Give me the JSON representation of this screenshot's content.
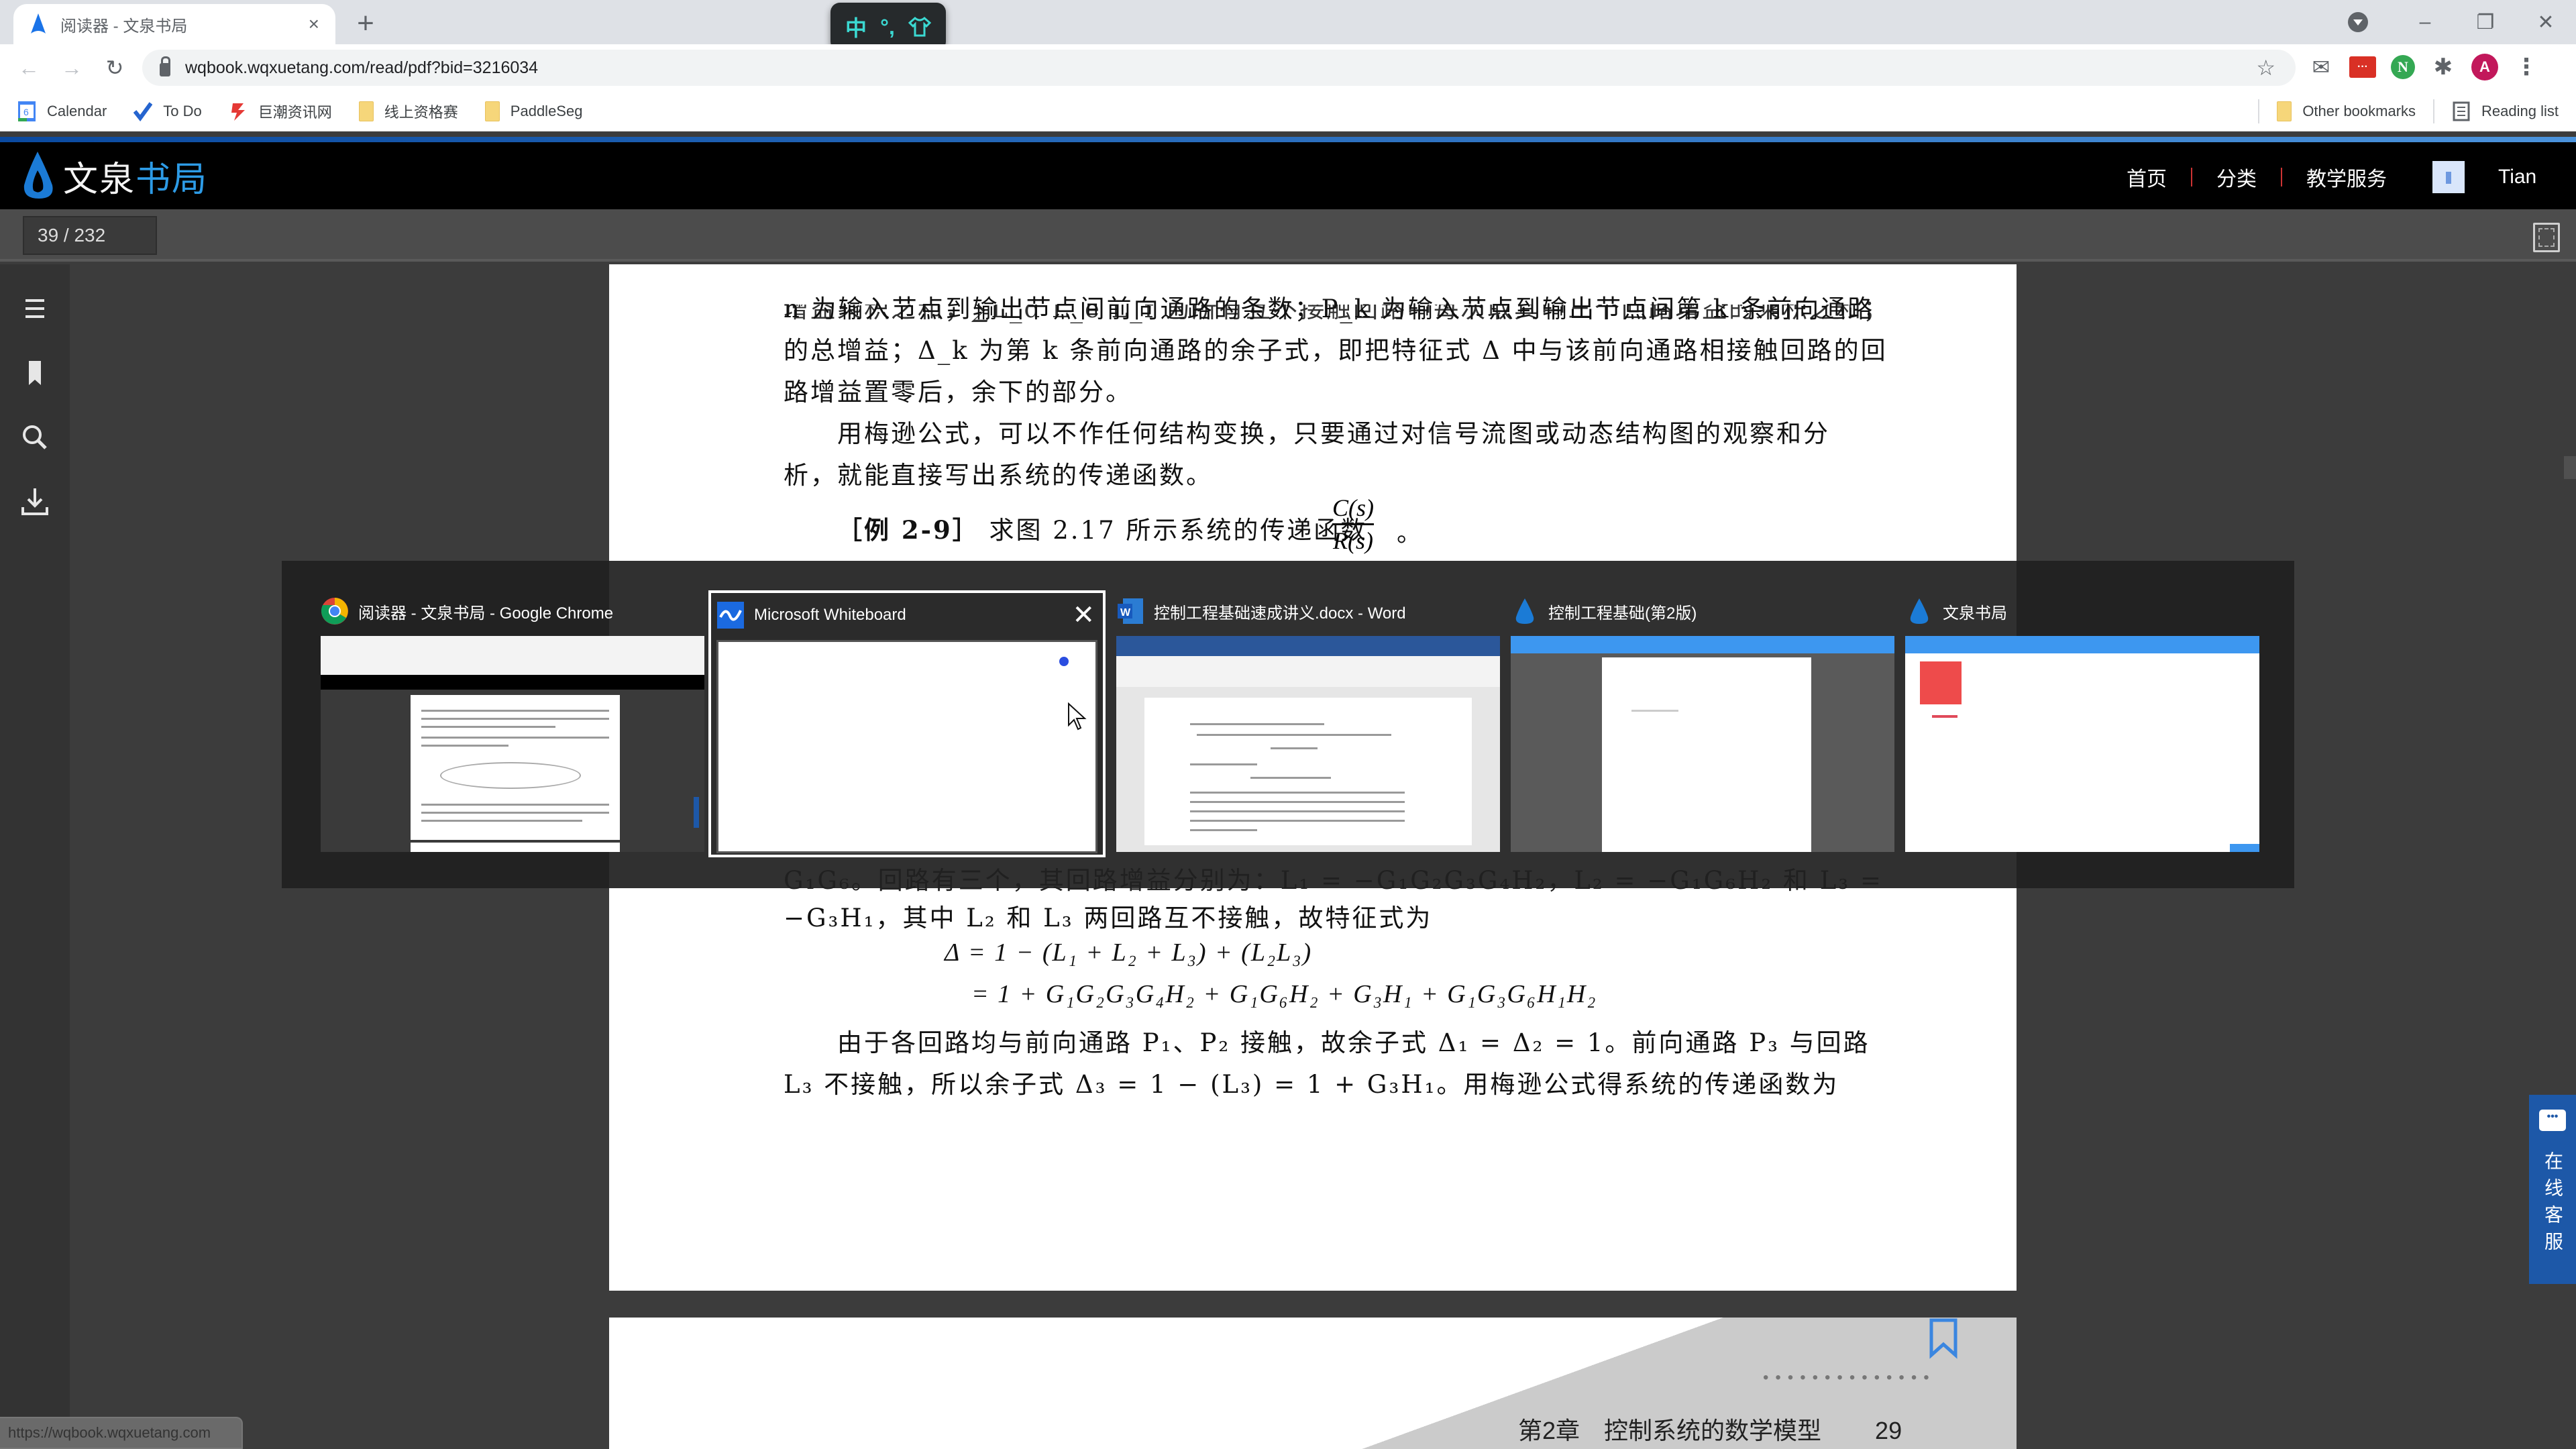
{
  "browser": {
    "tab_title": "阅读器 - 文泉书局",
    "tab_close": "×",
    "new_tab": "+",
    "url": "wqbook.wqxuetang.com/read/pdf?bid=3216034",
    "window_controls": {
      "minimize": "–",
      "restore": "❐",
      "close": "✕"
    },
    "extensions": [
      {
        "name": "mail",
        "glyph": "✉"
      },
      {
        "name": "red-extension",
        "glyph": "···"
      },
      {
        "name": "green-n",
        "glyph": "N"
      },
      {
        "name": "puzzle",
        "glyph": "✱"
      },
      {
        "name": "profile",
        "glyph": "A"
      },
      {
        "name": "menu",
        "glyph": "⋮"
      }
    ],
    "bookmarks": [
      {
        "label": "Calendar",
        "icon": "calendar-icon"
      },
      {
        "label": "To Do",
        "icon": "todo-check-icon"
      },
      {
        "label": "巨潮资讯网",
        "icon": "juchao-icon"
      },
      {
        "label": "线上资格赛",
        "icon": "folder-icon"
      },
      {
        "label": "PaddleSeg",
        "icon": "folder-icon"
      }
    ],
    "other_bookmarks": "Other bookmarks",
    "reading_list": "Reading list",
    "status_url": "https://wqbook.wqxuetang.com"
  },
  "ime": {
    "mode": "中",
    "punct": "°,",
    "skin": "👕"
  },
  "site": {
    "logo_part1": "文泉",
    "logo_part2": "书局",
    "nav": [
      "首页",
      "分类",
      "教学服务"
    ],
    "user_name": "Tian",
    "accent_color": "#2d9be6"
  },
  "reader": {
    "page_indicator": "39 / 232",
    "online_service": "在线客服",
    "page_footer_chapter": "第2章　控制系统的数学模型",
    "page_footer_number": "29"
  },
  "document": {
    "lines_top": [
      "n 为输入节点到输出节点间前向通路的条数；P_k 为输入节点到输出节点间第 k 条前向通路",
      "的总增益；Δ_k 为第 k 条前向通路的余子式，即把特征式 Δ 中与该前向通路相接触回路的回",
      "路增益置零后，余下的部分。",
      "用梅逊公式，可以不作任何结构变换，只要通过对信号流图或动态结构图的观察和分",
      "析，就能直接写出系统的传递函数。"
    ],
    "example_label": "［例 2-9］",
    "example_text": "求图 2.17 所示系统的传递函数",
    "frac_num": "C(s)",
    "frac_den": "R(s)",
    "frac_tail": "。",
    "partial_line": "G₁G₆。回路有三个，其回路增益分别为：L₁ = −G₁G₂G₃G₄H₂，L₂ = −G₁G₆H₂ 和 L₃ =",
    "lines_bottom": [
      "−G₃H₁，其中 L₂ 和 L₃ 两回路互不接触，故特征式为",
      "Δ = 1 − (L₁ + L₂ + L₃) + (L₂L₃)",
      "= 1 + G₁G₂G₃G₄H₂ + G₁G₆H₂ + G₃H₁ + G₁G₃G₆H₁H₂",
      "由于各回路均与前向通路 P₁、P₂ 接触，故余子式 Δ₁ = Δ₂ = 1。前向通路 P₃ 与回路",
      "L₃ 不接触，所以余子式 Δ₃ = 1 − (L₃) = 1 + G₃H₁。用梅逊公式得系统的传递函数为"
    ]
  },
  "switcher": {
    "items": [
      {
        "title": "阅读器 - 文泉书局 - Google Chrome",
        "icon": "chrome-icon",
        "selected": false
      },
      {
        "title": "Microsoft Whiteboard",
        "icon": "whiteboard-icon",
        "selected": true,
        "close": "✕"
      },
      {
        "title": "控制工程基础速成讲义.docx - Word",
        "icon": "word-icon",
        "selected": false
      },
      {
        "title": "控制工程基础(第2版)",
        "icon": "wenquan-icon",
        "selected": false
      },
      {
        "title": "文泉书局",
        "icon": "wenquan-icon",
        "selected": false
      }
    ]
  }
}
